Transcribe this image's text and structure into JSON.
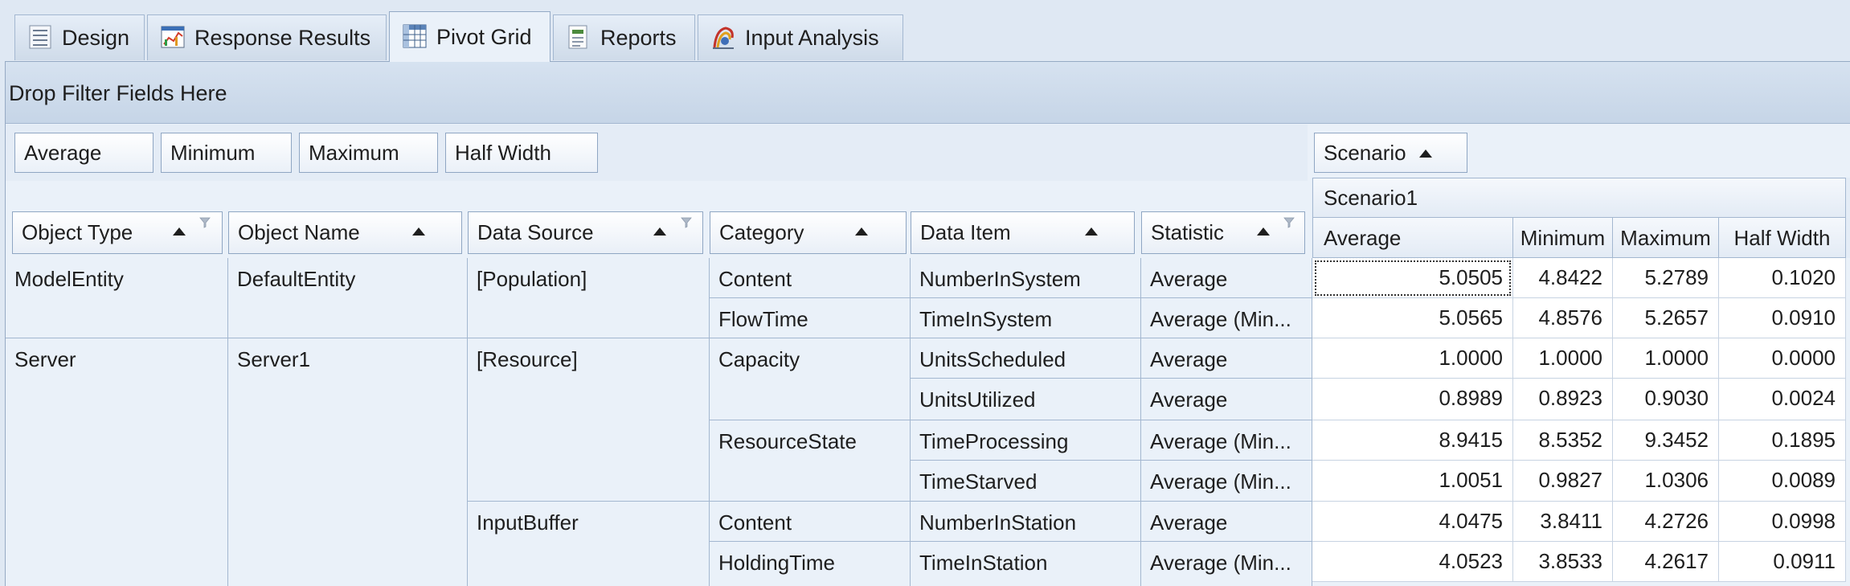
{
  "tabs": [
    {
      "label": "Design",
      "icon": "design-icon"
    },
    {
      "label": "Response Results",
      "icon": "response-results-icon"
    },
    {
      "label": "Pivot Grid",
      "icon": "pivot-grid-icon"
    },
    {
      "label": "Reports",
      "icon": "reports-icon"
    },
    {
      "label": "Input Analysis",
      "icon": "input-analysis-icon"
    }
  ],
  "active_tab": "Pivot Grid",
  "filter_area": {
    "placeholder": "Drop Filter Fields Here"
  },
  "data_fields": [
    "Average",
    "Minimum",
    "Maximum",
    "Half Width"
  ],
  "column_field": {
    "label": "Scenario"
  },
  "row_fields": [
    "Object Type",
    "Object Name",
    "Data Source",
    "Category",
    "Data Item",
    "Statistic"
  ],
  "scenario": "Scenario1",
  "value_headers": [
    "Average",
    "Minimum",
    "Maximum",
    "Half Width"
  ],
  "rows": [
    {
      "object_type": "ModelEntity",
      "object_name": "DefaultEntity",
      "data_source": "[Population]",
      "category": "Content",
      "data_item": "NumberInSystem",
      "statistic": "Average",
      "values": [
        "5.0505",
        "4.8422",
        "5.2789",
        "0.1020"
      ]
    },
    {
      "object_type": "",
      "object_name": "",
      "data_source": "",
      "category": "FlowTime",
      "data_item": "TimeInSystem",
      "statistic": "Average (Min...",
      "values": [
        "5.0565",
        "4.8576",
        "5.2657",
        "0.0910"
      ]
    },
    {
      "object_type": "Server",
      "object_name": "Server1",
      "data_source": "[Resource]",
      "category": "Capacity",
      "data_item": "UnitsScheduled",
      "statistic": "Average",
      "values": [
        "1.0000",
        "1.0000",
        "1.0000",
        "0.0000"
      ]
    },
    {
      "object_type": "",
      "object_name": "",
      "data_source": "",
      "category": "",
      "data_item": "UnitsUtilized",
      "statistic": "Average",
      "values": [
        "0.8989",
        "0.8923",
        "0.9030",
        "0.0024"
      ]
    },
    {
      "object_type": "",
      "object_name": "",
      "data_source": "",
      "category": "ResourceState",
      "data_item": "TimeProcessing",
      "statistic": "Average (Min...",
      "values": [
        "8.9415",
        "8.5352",
        "9.3452",
        "0.1895"
      ]
    },
    {
      "object_type": "",
      "object_name": "",
      "data_source": "",
      "category": "",
      "data_item": "TimeStarved",
      "statistic": "Average (Min...",
      "values": [
        "1.0051",
        "0.9827",
        "1.0306",
        "0.0089"
      ]
    },
    {
      "object_type": "",
      "object_name": "",
      "data_source": "InputBuffer",
      "category": "Content",
      "data_item": "NumberInStation",
      "statistic": "Average",
      "values": [
        "4.0475",
        "3.8411",
        "4.2726",
        "0.0998"
      ]
    },
    {
      "object_type": "",
      "object_name": "",
      "data_source": "",
      "category": "HoldingTime",
      "data_item": "TimeInStation",
      "statistic": "Average (Min...",
      "values": [
        "4.0523",
        "3.8533",
        "4.2617",
        "0.0911"
      ]
    }
  ]
}
